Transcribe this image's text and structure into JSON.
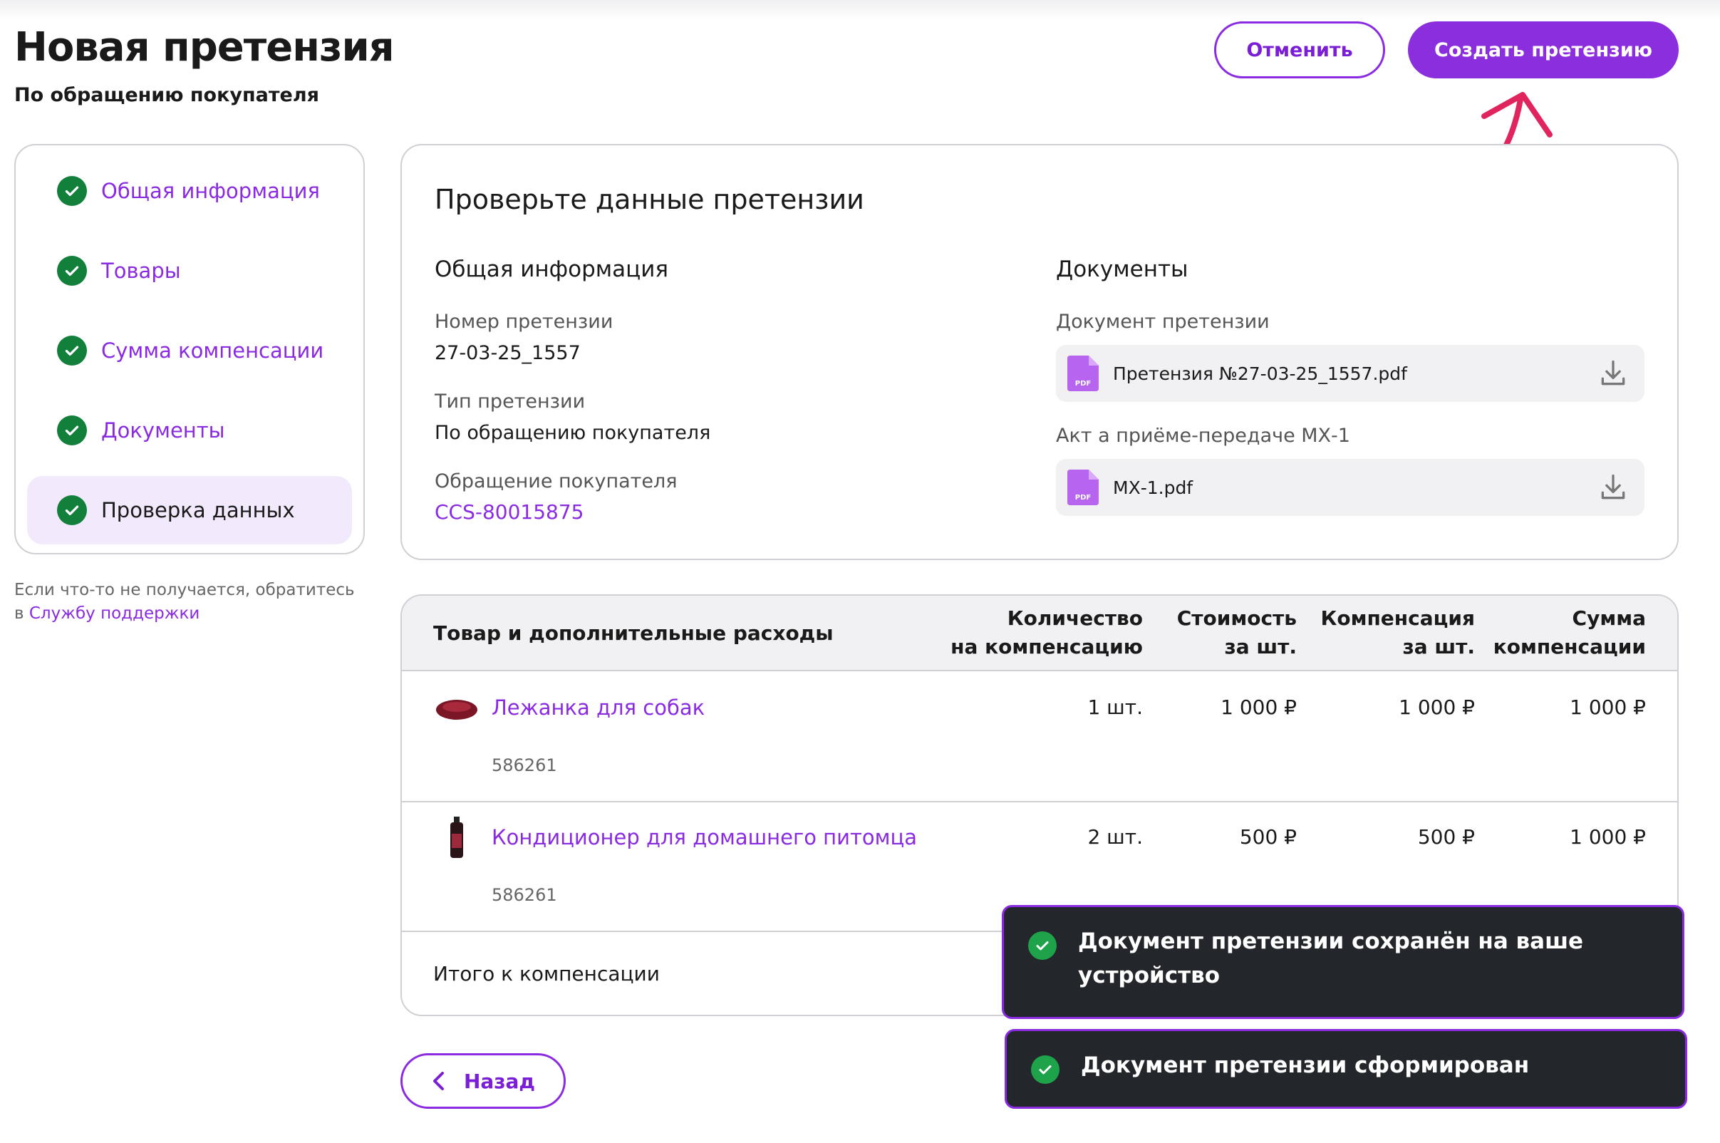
{
  "header": {
    "title": "Новая претензия",
    "subtitle": "По обращению покупателя",
    "cancel_label": "Отменить",
    "create_label": "Создать претензию"
  },
  "stepper": {
    "items": [
      {
        "label": "Общая информация",
        "done": true
      },
      {
        "label": "Товары",
        "done": true
      },
      {
        "label": "Сумма компенсации",
        "done": true
      },
      {
        "label": "Документы",
        "done": true
      },
      {
        "label": "Проверка данных",
        "done": true,
        "active": true
      }
    ]
  },
  "help": {
    "text": "Если что-то не получается, обратитесь",
    "prefix": "в",
    "link": "Службу поддержки"
  },
  "review": {
    "title": "Проверьте данные претензии",
    "general": {
      "heading": "Общая информация",
      "claim_number_label": "Номер претензии",
      "claim_number": "27-03-25_1557",
      "claim_type_label": "Тип претензии",
      "claim_type": "По обращению покупателя",
      "customer_request_label": "Обращение покупателя",
      "customer_request": "CCS-80015875"
    },
    "documents": {
      "heading": "Документы",
      "items": [
        {
          "label": "Документ претензии",
          "file": "Претензия №27-03-25_1557.pdf",
          "icon": "PDF"
        },
        {
          "label": "Акт а приёме-передаче МХ-1",
          "file": "МХ-1.pdf",
          "icon": "PDF"
        }
      ]
    }
  },
  "table": {
    "headers": {
      "product": "Товар и дополнительные расходы",
      "qty": [
        "Количество",
        "на компенсацию"
      ],
      "price": [
        "Стоимость",
        "за шт."
      ],
      "comp": [
        "Компенсация",
        "за шт."
      ],
      "sum": [
        "Сумма",
        "компенсации"
      ]
    },
    "rows": [
      {
        "name": "Лежанка для собак",
        "sku": "586261",
        "qty": "1 шт.",
        "price": "1 000 ₽",
        "comp": "1 000 ₽",
        "sum": "1 000 ₽"
      },
      {
        "name": "Кондиционер для домашнего питомца",
        "sku": "586261",
        "qty": "2 шт.",
        "price": "500 ₽",
        "comp": "500 ₽",
        "sum": "1 000 ₽"
      }
    ],
    "total_label": "Итого к компенсации"
  },
  "back_label": "Назад",
  "toasts": [
    {
      "text": "Документ претензии сохранён на ваше устройство"
    },
    {
      "text": "Документ претензии сформирован"
    }
  ],
  "colors": {
    "accent": "#8b2ede",
    "success": "#12803a",
    "toast_bg": "#23262b",
    "arrow": "#e0245e"
  }
}
